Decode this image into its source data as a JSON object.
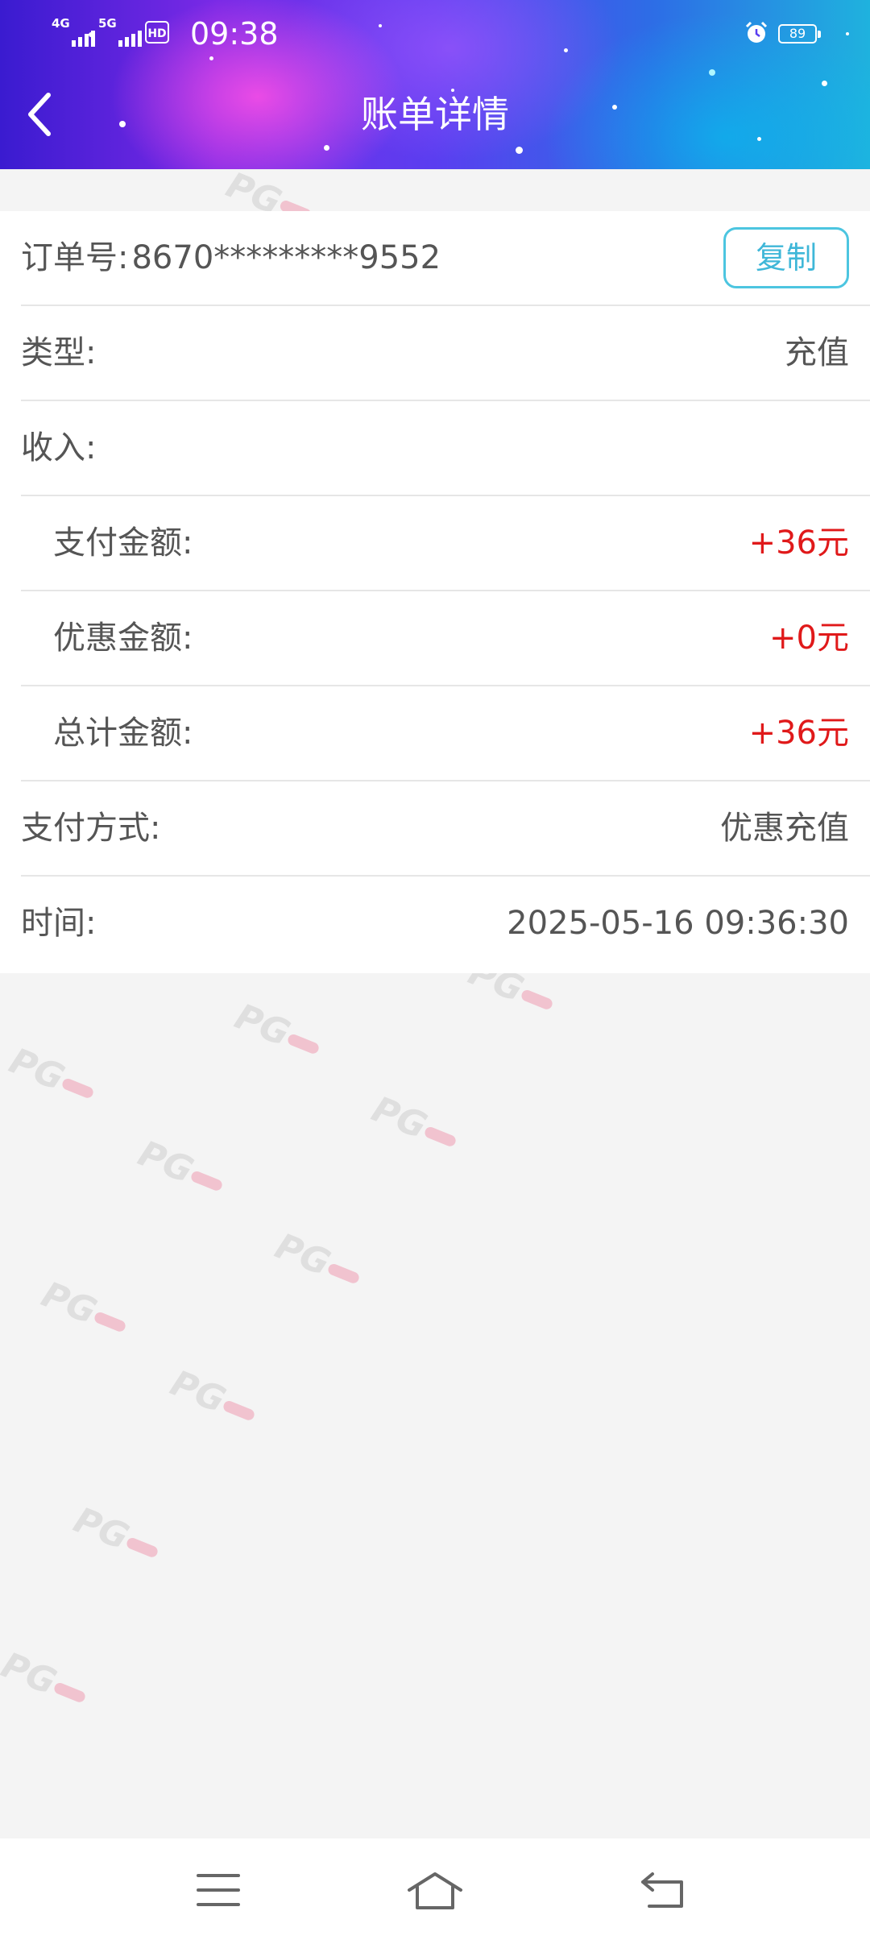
{
  "status_bar": {
    "sig1_label": "4G",
    "sig2_label": "5G",
    "hd_label": "HD",
    "time": "09:38",
    "battery": "89",
    "icons": [
      "signal-4g-icon",
      "signal-5g-icon",
      "hd-voice-icon",
      "alarm-icon",
      "battery-icon"
    ]
  },
  "header": {
    "title": "账单详情",
    "back_icon": "chevron-left-icon"
  },
  "order": {
    "label": "订单号:",
    "number": "8670*********9552",
    "copy_label": "复制"
  },
  "rows": [
    {
      "label": "类型:",
      "value": "充值"
    },
    {
      "label": "收入:",
      "value": ""
    },
    {
      "label": "支付金额:",
      "value": "+36元"
    },
    {
      "label": "优惠金额:",
      "value": "+0元"
    },
    {
      "label": "总计金额:",
      "value": "+36元"
    },
    {
      "label": "支付方式:",
      "value": "优惠充值"
    },
    {
      "label": "时间:",
      "value": "2025-05-16 09:36:30"
    }
  ],
  "watermark": "PG",
  "colors": {
    "amount_red": "#e0191a",
    "copy_accent": "#4cc5e0",
    "page_bg": "#f4f4f4"
  },
  "bottom_nav": {
    "icons": [
      "menu-icon",
      "home-icon",
      "back-icon"
    ]
  }
}
